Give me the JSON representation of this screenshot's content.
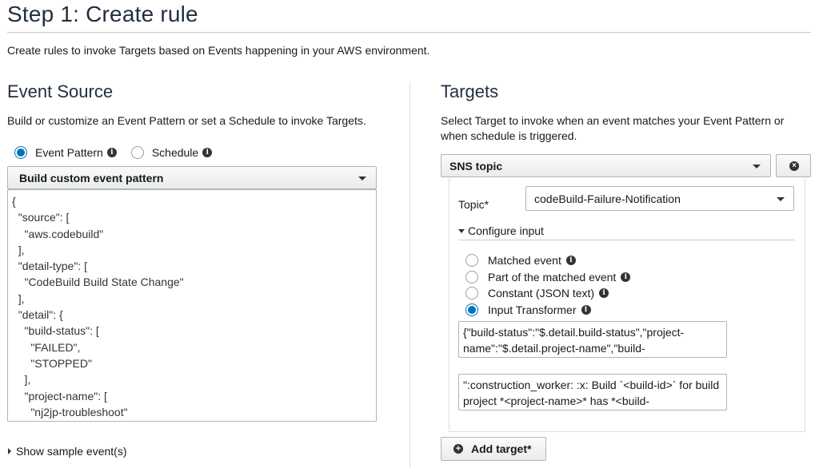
{
  "header": {
    "title": "Step 1: Create rule",
    "intro": "Create rules to invoke Targets based on Events happening in your AWS environment."
  },
  "event_source": {
    "title": "Event Source",
    "description": "Build or customize an Event Pattern or set a Schedule to invoke Targets.",
    "options": [
      {
        "label": "Event Pattern",
        "selected": true
      },
      {
        "label": "Schedule",
        "selected": false
      }
    ],
    "pattern_select": "Build custom event pattern",
    "pattern_code": "{\n  \"source\": [\n    \"aws.codebuild\"\n  ],\n  \"detail-type\": [\n    \"CodeBuild Build State Change\"\n  ],\n  \"detail\": {\n    \"build-status\": [\n      \"FAILED\",\n      \"STOPPED\"\n    ],\n    \"project-name\": [\n      \"nj2jp-troubleshoot\"",
    "sample_link": "Show sample event(s)"
  },
  "targets": {
    "title": "Targets",
    "description": "Select Target to invoke when an event matches your Event Pattern or when schedule is triggered.",
    "target_type": "SNS topic",
    "topic_label": "Topic*",
    "topic_value": "codeBuild-Failure-Notification",
    "configure_input_label": "Configure input",
    "input_options": [
      {
        "label": "Matched event",
        "selected": false
      },
      {
        "label": "Part of the matched event",
        "selected": false
      },
      {
        "label": "Constant (JSON text)",
        "selected": false
      },
      {
        "label": "Input Transformer",
        "selected": true
      }
    ],
    "input_paths_text": "{\"build-status\":\"$.detail.build-status\",\"project-name\":\"$.detail.project-name\",\"build-",
    "input_template_text": "\":construction_worker: :x: Build `<build-id>` for build project *<project-name>* has *<build-",
    "add_target_label": "Add target*"
  },
  "icons": {
    "info": "info-icon",
    "remove": "remove-circle-icon",
    "add": "add-circle-icon"
  },
  "colors": {
    "accent": "#0073bb",
    "heading": "#232f3e"
  }
}
